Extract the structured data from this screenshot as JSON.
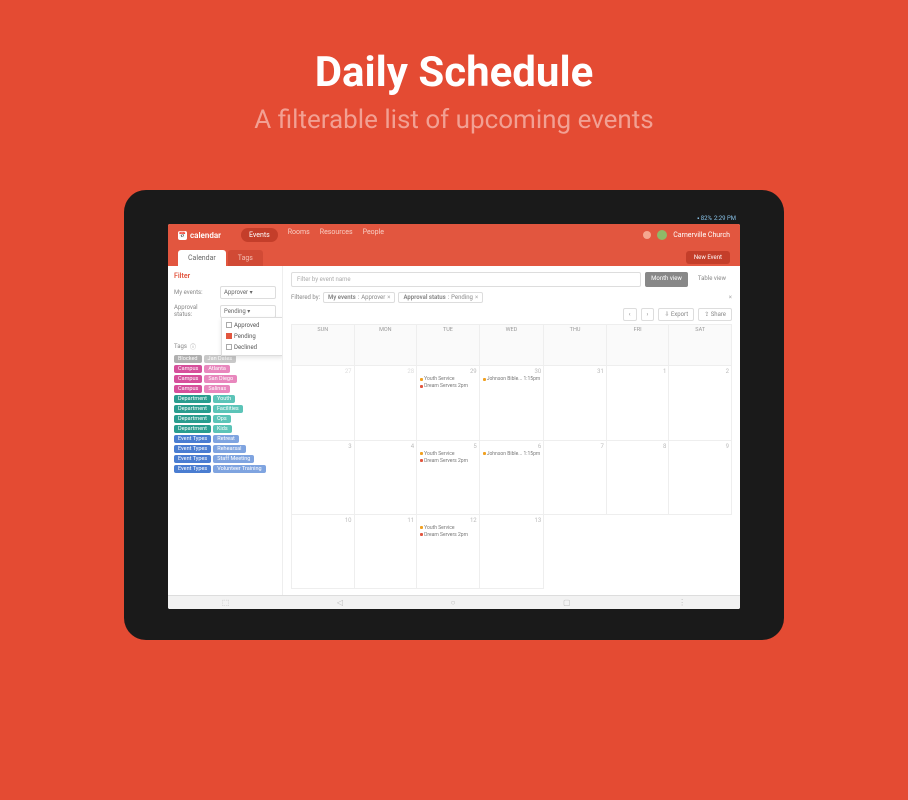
{
  "hero": {
    "title": "Daily Schedule",
    "subtitle": "A filterable list of upcoming events"
  },
  "status": {
    "battery": "82%",
    "time": "2:29 PM"
  },
  "header": {
    "app_name": "calendar",
    "nav": [
      "Events",
      "Rooms",
      "Resources",
      "People"
    ],
    "church": "Carnerville Church"
  },
  "tabs": {
    "calendar": "Calendar",
    "tags": "Tags",
    "new_event": "New Event"
  },
  "sidebar": {
    "filter_title": "Filter",
    "my_events_label": "My events:",
    "my_events_value": "Approver",
    "approval_label": "Approval status:",
    "approval_value": "Pending",
    "dropdown_opts": [
      "Approved",
      "Pending",
      "Declined"
    ],
    "tags_title": "Tags",
    "tags": [
      {
        "cat": "Blocked",
        "catColor": "#b0b0b0",
        "val": "Jan Dates",
        "valColor": "#c9c9c9"
      },
      {
        "cat": "Campus",
        "catColor": "#d64f9b",
        "val": "Atlanta",
        "valColor": "#e887bd"
      },
      {
        "cat": "Campus",
        "catColor": "#d64f9b",
        "val": "San Diego",
        "valColor": "#e887bd"
      },
      {
        "cat": "Campus",
        "catColor": "#d64f9b",
        "val": "Salinas",
        "valColor": "#e887bd"
      },
      {
        "cat": "Department",
        "catColor": "#2a9d8f",
        "val": "Youth",
        "valColor": "#5cc4b8"
      },
      {
        "cat": "Department",
        "catColor": "#2a9d8f",
        "val": "Facilities",
        "valColor": "#5cc4b8"
      },
      {
        "cat": "Department",
        "catColor": "#2a9d8f",
        "val": "Ops",
        "valColor": "#5cc4b8"
      },
      {
        "cat": "Department",
        "catColor": "#2a9d8f",
        "val": "Kids",
        "valColor": "#5cc4b8"
      },
      {
        "cat": "Event Types",
        "catColor": "#4a7dd1",
        "val": "Retreat",
        "valColor": "#7fa4e0"
      },
      {
        "cat": "Event Types",
        "catColor": "#4a7dd1",
        "val": "Rehearsal",
        "valColor": "#7fa4e0"
      },
      {
        "cat": "Event Types",
        "catColor": "#4a7dd1",
        "val": "Staff Meeting",
        "valColor": "#7fa4e0"
      },
      {
        "cat": "Event Types",
        "catColor": "#4a7dd1",
        "val": "Volunteer Training",
        "valColor": "#7fa4e0"
      }
    ]
  },
  "content": {
    "search_placeholder": "Filter by event name",
    "month_view": "Month view",
    "table_view": "Table view",
    "filtered_by": "Filtered by:",
    "chips": [
      {
        "k": "My events",
        "v": "Approver"
      },
      {
        "k": "Approval status",
        "v": "Pending"
      }
    ],
    "export": "Export",
    "share": "Share",
    "days": [
      "SUN",
      "MON",
      "TUE",
      "WED",
      "THU",
      "FRI",
      "SAT"
    ],
    "cells": [
      {
        "d": "27",
        "other": true
      },
      {
        "d": "28",
        "other": true
      },
      {
        "d": "29",
        "evts": [
          {
            "c": "#f0a020",
            "t": "Youth Service"
          },
          {
            "c": "#e2563f",
            "t": "Dream Servers 2pm"
          }
        ]
      },
      {
        "d": "30",
        "evts": [
          {
            "c": "#f0a020",
            "t": "Johnson Bible... 1:15pm"
          }
        ]
      },
      {
        "d": "31"
      },
      {
        "d": "1"
      },
      {
        "d": "2"
      },
      {
        "d": "3"
      },
      {
        "d": "4"
      },
      {
        "d": "5",
        "evts": [
          {
            "c": "#f0a020",
            "t": "Youth Service"
          },
          {
            "c": "#e2563f",
            "t": "Dream Servers 2pm"
          }
        ]
      },
      {
        "d": "6",
        "evts": [
          {
            "c": "#f0a020",
            "t": "Johnson Bible... 1:15pm"
          }
        ]
      },
      {
        "d": "7"
      },
      {
        "d": "8"
      },
      {
        "d": "9"
      },
      {
        "d": "10"
      },
      {
        "d": "11"
      },
      {
        "d": "12",
        "evts": [
          {
            "c": "#f0a020",
            "t": "Youth Service"
          },
          {
            "c": "#e2563f",
            "t": "Dream Servers 2pm"
          }
        ]
      },
      {
        "d": "13"
      }
    ]
  }
}
